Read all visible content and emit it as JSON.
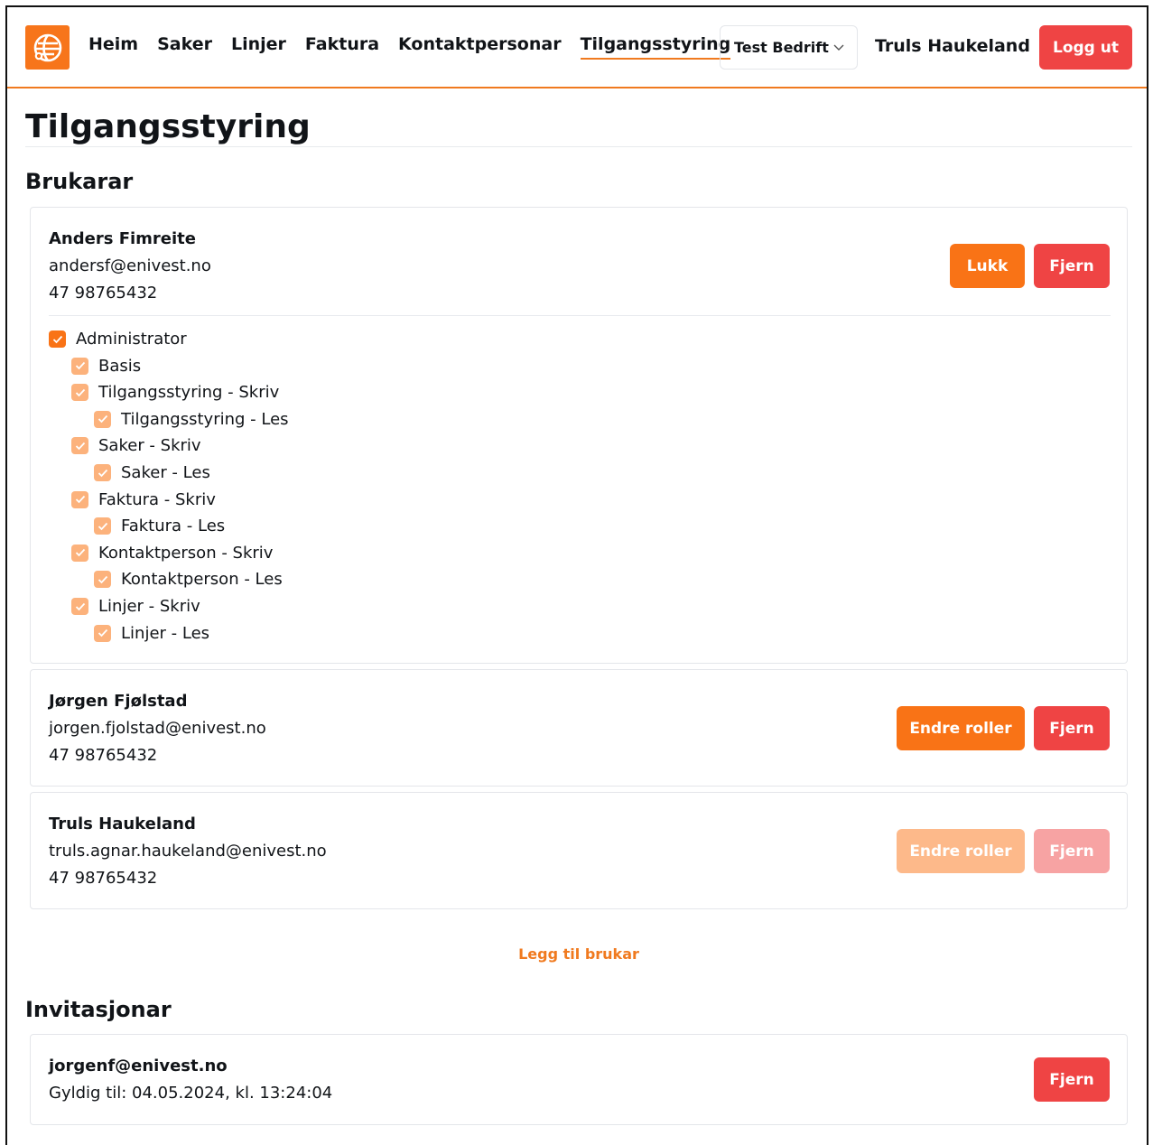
{
  "nav": {
    "items": [
      "Heim",
      "Saker",
      "Linjer",
      "Faktura",
      "Kontaktpersonar",
      "Tilgangsstyring"
    ],
    "active": "Tilgangsstyring",
    "company": "Test Bedrift",
    "user": "Truls Haukeland",
    "logout": "Logg ut"
  },
  "page": {
    "title": "Tilgangsstyring",
    "users_heading": "Brukarar",
    "invites_heading": "Invitasjonar",
    "add_user": "Legg til brukar"
  },
  "users": [
    {
      "name": "Anders Fimreite",
      "email": "andersf@enivest.no",
      "phone": "47 98765432",
      "primary_button": "Lukk",
      "remove_button": "Fjern",
      "roles": [
        {
          "label": "Administrator",
          "level": 0,
          "checked": true
        },
        {
          "label": "Basis",
          "level": 1,
          "checked": true
        },
        {
          "label": "Tilgangsstyring - Skriv",
          "level": 1,
          "checked": true
        },
        {
          "label": "Tilgangsstyring - Les",
          "level": 2,
          "checked": true
        },
        {
          "label": "Saker - Skriv",
          "level": 1,
          "checked": true
        },
        {
          "label": "Saker - Les",
          "level": 2,
          "checked": true
        },
        {
          "label": "Faktura - Skriv",
          "level": 1,
          "checked": true
        },
        {
          "label": "Faktura - Les",
          "level": 2,
          "checked": true
        },
        {
          "label": "Kontaktperson - Skriv",
          "level": 1,
          "checked": true
        },
        {
          "label": "Kontaktperson - Les",
          "level": 2,
          "checked": true
        },
        {
          "label": "Linjer - Skriv",
          "level": 1,
          "checked": true
        },
        {
          "label": "Linjer - Les",
          "level": 2,
          "checked": true
        }
      ]
    },
    {
      "name": "Jørgen Fjølstad",
      "email": "jorgen.fjolstad@enivest.no",
      "phone": "47 98765432",
      "primary_button": "Endre roller",
      "remove_button": "Fjern"
    },
    {
      "name": "Truls Haukeland",
      "email": "truls.agnar.haukeland@enivest.no",
      "phone": "47 98765432",
      "primary_button": "Endre roller",
      "remove_button": "Fjern"
    }
  ],
  "invitations": [
    {
      "email": "jorgenf@enivest.no",
      "valid_until": "Gyldig til: 04.05.2024, kl. 13:24:04",
      "remove_button": "Fjern"
    }
  ],
  "colors": {
    "accent": "#f97316",
    "danger": "#ef4444",
    "accent_disabled": "#fdb98a",
    "danger_disabled": "#f7a3a3"
  }
}
